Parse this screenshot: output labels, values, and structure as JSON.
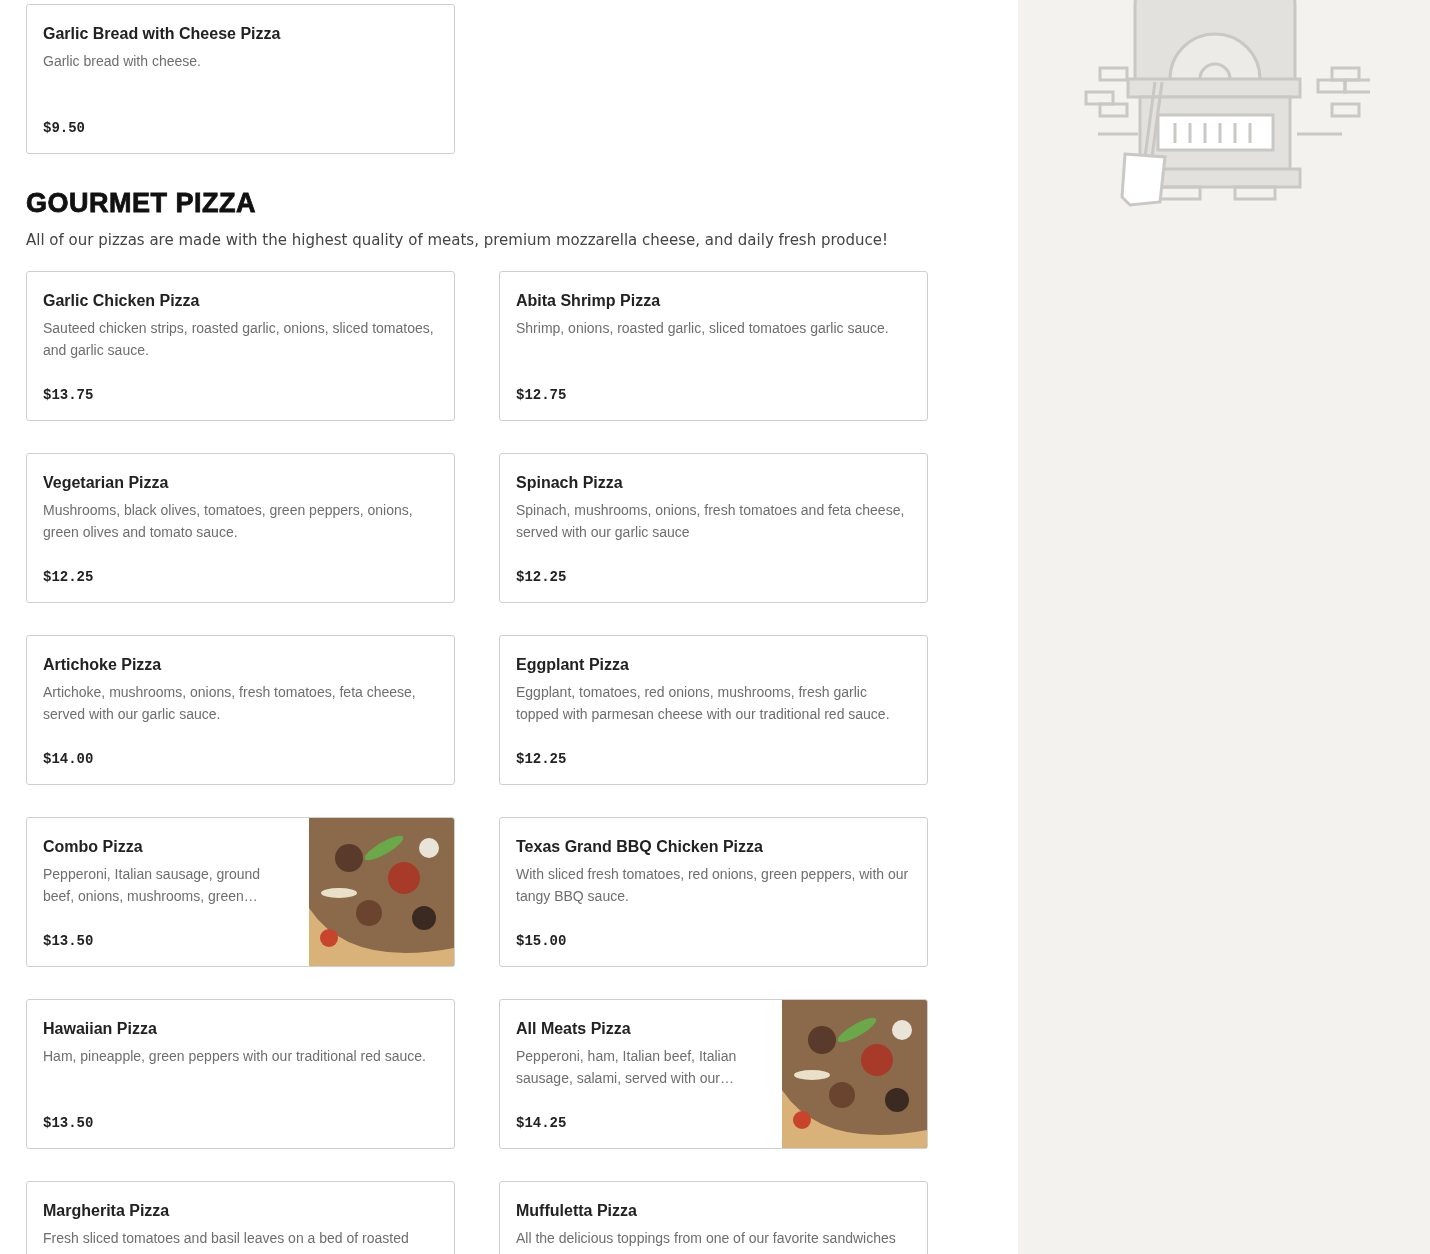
{
  "previous_item": {
    "name": "Garlic Bread with Cheese Pizza",
    "description": "Garlic bread with cheese.",
    "price": "$9.50"
  },
  "section": {
    "title": "GOURMET PIZZA",
    "description": "All of our pizzas are made with the highest quality of meats, premium mozzarella cheese, and daily fresh produce!",
    "items": [
      {
        "name": "Garlic Chicken Pizza",
        "description": "Sauteed chicken strips, roasted garlic, onions, sliced tomatoes, and garlic sauce.",
        "price": "$13.75",
        "has_picture": false
      },
      {
        "name": "Abita Shrimp Pizza",
        "description": "Shrimp, onions, roasted garlic, sliced tomatoes garlic sauce.",
        "price": "$12.75",
        "has_picture": false
      },
      {
        "name": "Vegetarian Pizza",
        "description": "Mushrooms, black olives, tomatoes, green peppers, onions, green olives and tomato sauce.",
        "price": "$12.25",
        "has_picture": false
      },
      {
        "name": "Spinach Pizza",
        "description": "Spinach, mushrooms, onions, fresh tomatoes and feta cheese, served with our garlic sauce",
        "price": "$12.25",
        "has_picture": false
      },
      {
        "name": "Artichoke Pizza",
        "description": "Artichoke, mushrooms, onions, fresh tomatoes, feta cheese, served with our garlic sauce.",
        "price": "$14.00",
        "has_picture": false
      },
      {
        "name": "Eggplant Pizza",
        "description": "Eggplant, tomatoes, red onions, mushrooms, fresh garlic topped with parmesan cheese with our traditional red sauce.",
        "price": "$12.25",
        "has_picture": false
      },
      {
        "name": "Combo Pizza",
        "description": "Pepperoni, Italian sausage, ground beef, onions, mushrooms, green…",
        "price": "$13.50",
        "has_picture": true
      },
      {
        "name": "Texas Grand BBQ Chicken Pizza",
        "description": "With sliced fresh tomatoes, red onions, green peppers, with our tangy BBQ sauce.",
        "price": "$15.00",
        "has_picture": false
      },
      {
        "name": "Hawaiian Pizza",
        "description": "Ham, pineapple, green peppers with our traditional red sauce.",
        "price": "$13.50",
        "has_picture": false
      },
      {
        "name": "All Meats Pizza",
        "description": "Pepperoni, ham, Italian beef, Italian sausage, salami, served with our…",
        "price": "$14.25",
        "has_picture": true
      },
      {
        "name": "Margherita Pizza",
        "description": "Fresh sliced tomatoes and basil leaves on a bed of roasted",
        "has_picture": false
      },
      {
        "name": "Muffuletta Pizza",
        "description": "All the delicious toppings from one of our favorite sandwiches",
        "has_picture": false
      }
    ]
  }
}
